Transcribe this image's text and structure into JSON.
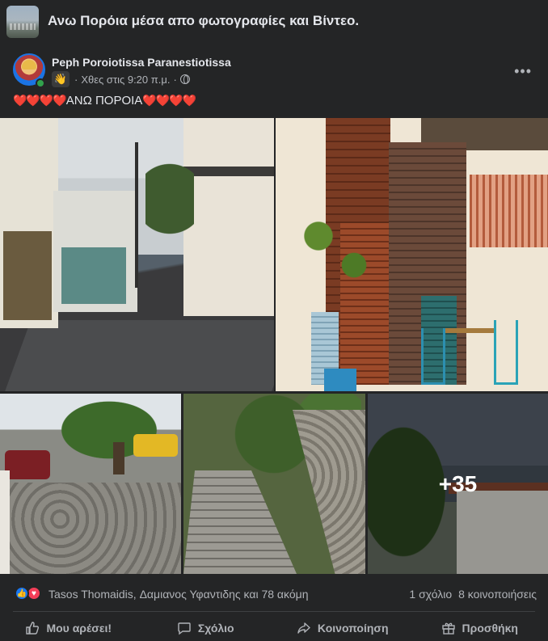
{
  "group": {
    "title": "Ανω Πορόια μέσα απο φωτογραφίες και Βίντεο."
  },
  "post": {
    "author": "Peph Poroiotissa Paranestiotissa",
    "time": "Χθες στις 9:20 π.μ.",
    "separator": "·",
    "text_before": "❤️❤️❤️❤️",
    "text_main": "ΑΝΩ ΠΟΡΟΙΑ",
    "text_after": "❤️❤️❤️❤️",
    "more_photos": "+35"
  },
  "reactions": {
    "names": "Tasos Thomaidis, Δαμιανος Υφαντιδης και 78 ακόμη",
    "comments": "1 σχόλιο",
    "shares": "8 κοινοποιήσεις"
  },
  "actions": {
    "like": "Μου αρέσει!",
    "comment": "Σχόλιο",
    "share": "Κοινοποίηση",
    "add": "Προσθήκη"
  },
  "icons": {
    "more": "more-options-icon",
    "globe": "globe-icon",
    "wave": "wave-hand-icon"
  },
  "colors": {
    "background": "#242526",
    "text": "#e4e6eb",
    "secondary": "#b0b3b8",
    "like_blue": "#1877f2",
    "love_red": "#f33e58"
  }
}
